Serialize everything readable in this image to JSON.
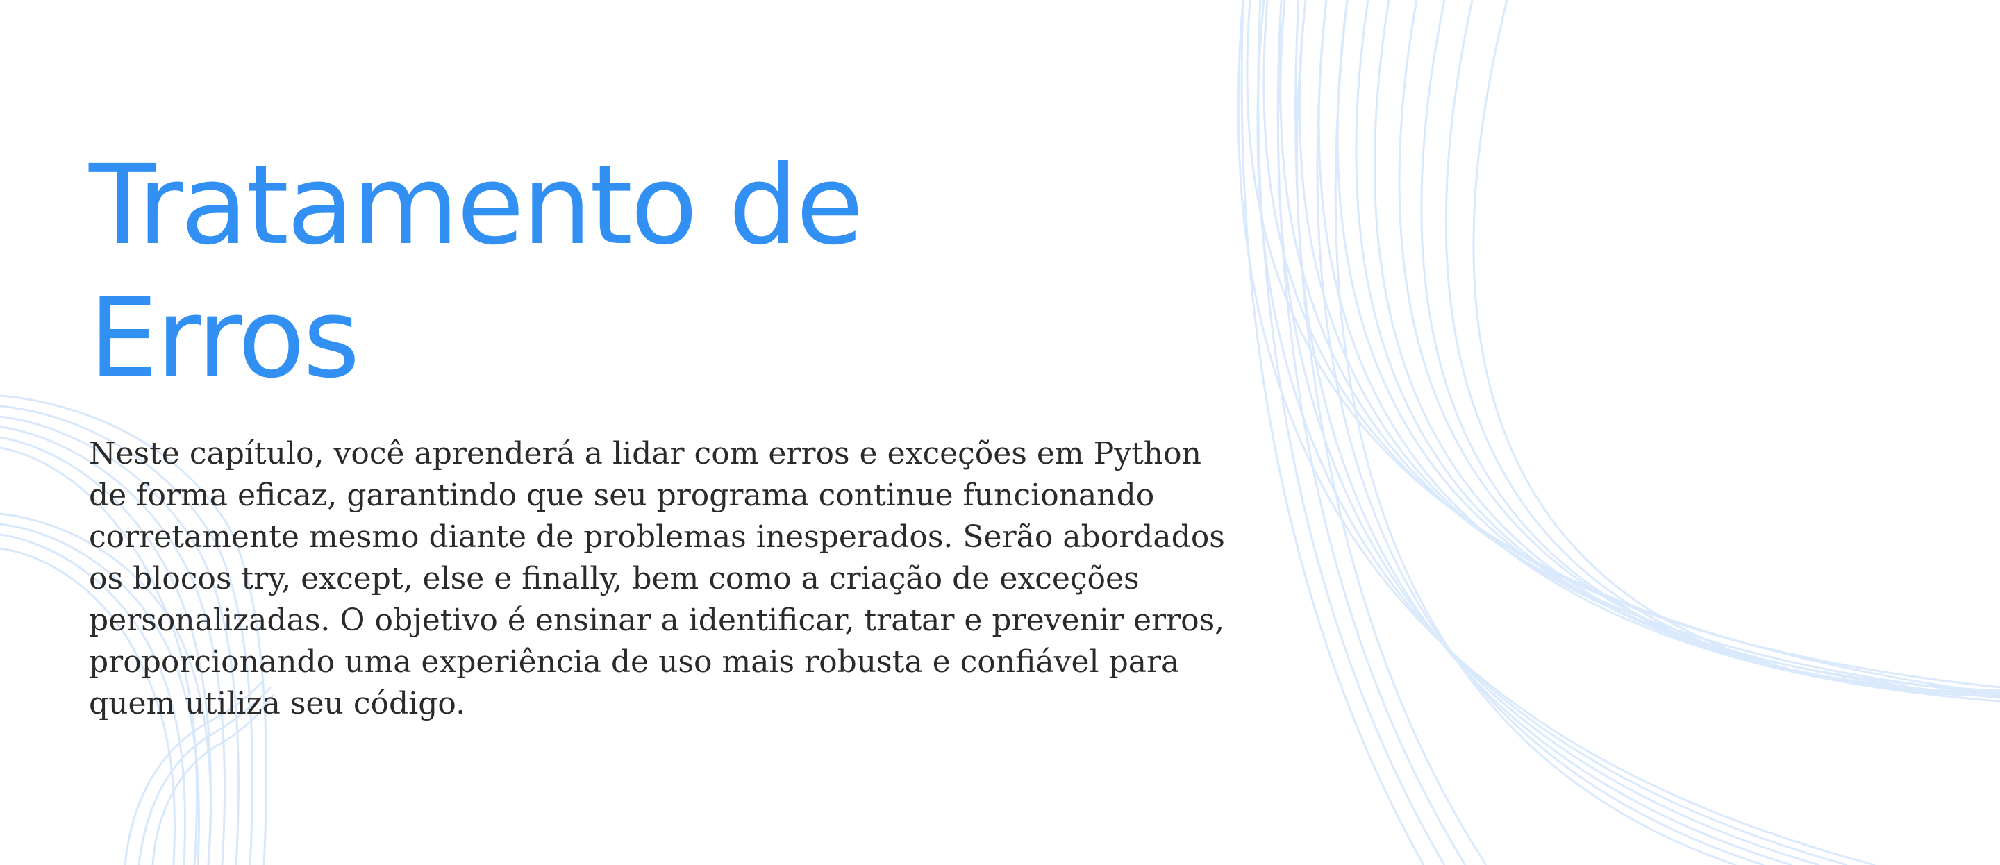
{
  "slide": {
    "title": "Tratamento de Erros",
    "body": "Neste capítulo, você aprenderá a lidar com erros e exceções em Python de forma eficaz, garantindo que seu programa continue funcionando corretamente mesmo diante de problemas inesperados. Serão abordados os blocos try, except, else e finally, bem como a criação de exceções personalizadas. O objetivo é ensinar a identificar, tratar e prevenir erros, proporcionando uma experiência de uso mais robusta e confiável para quem utiliza seu código."
  },
  "colors": {
    "title": "#3390f3",
    "body_text": "#2a2a2a",
    "decor_lines": "#cfe3fb",
    "background": "#ffffff"
  }
}
